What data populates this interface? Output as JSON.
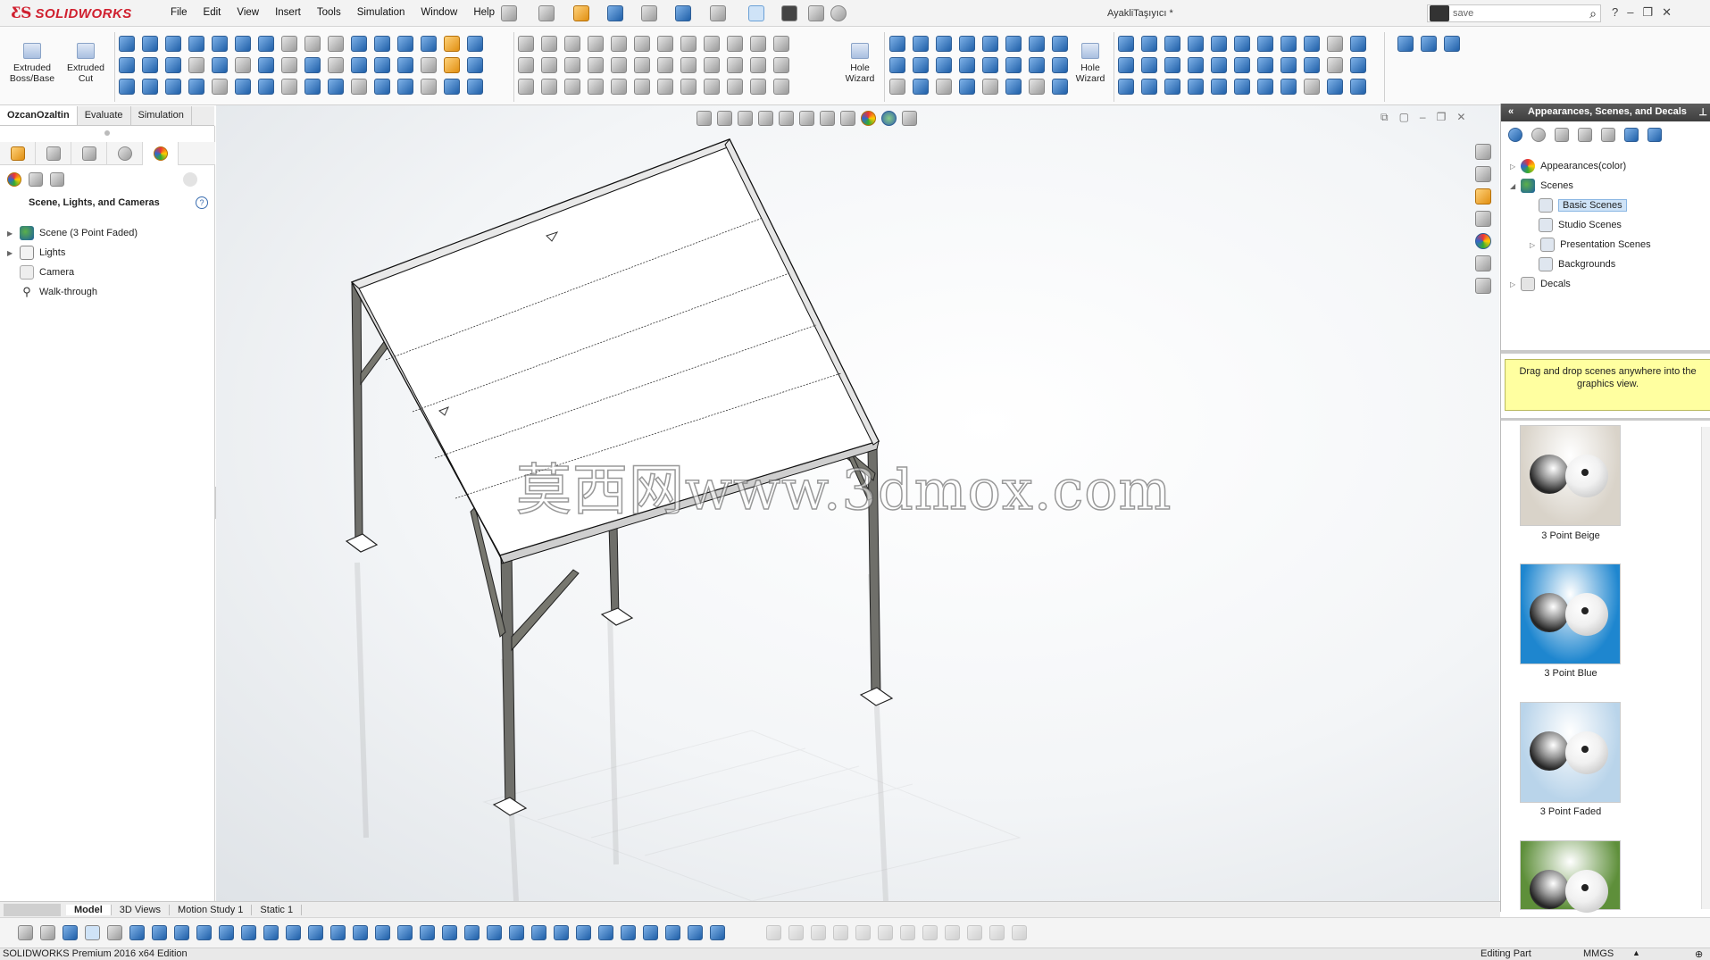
{
  "app": {
    "brand": "SOLIDWORKS",
    "document_title": "AyakliTaşıyıcı *"
  },
  "menu": [
    "File",
    "Edit",
    "View",
    "Insert",
    "Tools",
    "Simulation",
    "Window",
    "Help"
  ],
  "search": {
    "value": "save"
  },
  "ribbon": {
    "extruded_boss": "Extruded Boss/Base",
    "extruded_cut": "Extruded Cut",
    "hole_wizard_1": "Hole Wizard",
    "hole_wizard_2": "Hole Wizard"
  },
  "command_tabs": [
    "OzcanOzaltin",
    "Evaluate",
    "Simulation"
  ],
  "left_panel": {
    "header": "Scene, Lights, and Cameras",
    "tree": [
      {
        "label": "Scene (3 Point Faded)",
        "icon": "scene-icon"
      },
      {
        "label": "Lights",
        "icon": "lights-icon"
      },
      {
        "label": "Camera",
        "icon": "camera-icon"
      },
      {
        "label": "Walk-through",
        "icon": "walk-through-icon"
      }
    ]
  },
  "watermark": "莫西网www.3dmox.com",
  "right_panel": {
    "title": "Appearances, Scenes, and Decals",
    "tree": [
      {
        "label": "Appearances(color)"
      },
      {
        "label": "Scenes"
      },
      {
        "label": "Basic Scenes"
      },
      {
        "label": "Studio Scenes"
      },
      {
        "label": "Presentation Scenes"
      },
      {
        "label": "Backgrounds"
      },
      {
        "label": "Decals"
      }
    ],
    "hint": "Drag and drop scenes anywhere into the graphics view.",
    "scenes": [
      {
        "label": "3 Point Beige",
        "color": "#d9d3c9"
      },
      {
        "label": "3 Point Blue",
        "color": "#1e86cf"
      },
      {
        "label": "3 Point Faded",
        "color": "#b9d4ea"
      },
      {
        "label": "",
        "color": "#5e8f3a"
      }
    ]
  },
  "bottom_tabs": [
    "Model",
    "3D Views",
    "Motion Study 1",
    "Static 1"
  ],
  "status": {
    "edition": "SOLIDWORKS Premium 2016 x64 Edition",
    "mode": "Editing Part",
    "units": "MMGS"
  }
}
